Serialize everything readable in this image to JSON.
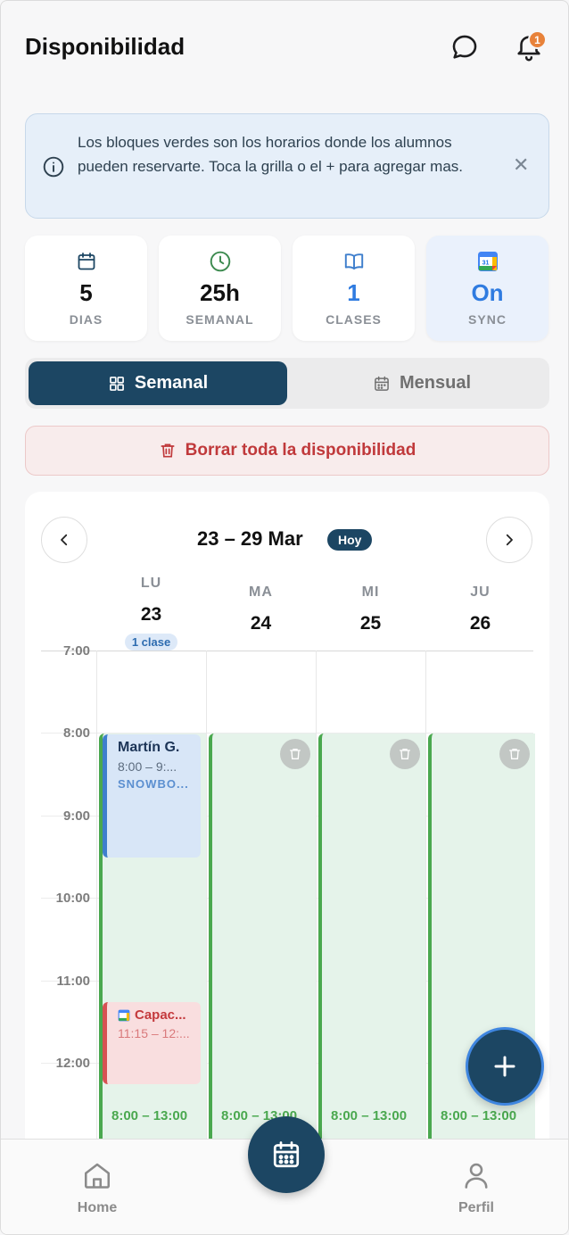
{
  "header": {
    "title": "Disponibilidad",
    "notification_count": "1"
  },
  "info_banner": {
    "text": "Los bloques verdes son los horarios donde los alumnos pueden reservarte. Toca la grilla o el + para agregar mas."
  },
  "stats": [
    {
      "icon": "calendar-icon",
      "value": "5",
      "label": "DIAS"
    },
    {
      "icon": "clock-icon",
      "value": "25h",
      "label": "SEMANAL"
    },
    {
      "icon": "book-icon",
      "value": "1",
      "label": "CLASES"
    },
    {
      "icon": "google-calendar-icon",
      "value": "On",
      "label": "SYNC"
    }
  ],
  "view_toggle": {
    "weekly_label": "Semanal",
    "monthly_label": "Mensual",
    "selected": "Semanal"
  },
  "clear_button": {
    "label": "Borrar toda la disponibilidad"
  },
  "calendar": {
    "range": "23 – 29 Mar",
    "today_label": "Hoy",
    "days": [
      {
        "name": "LU",
        "num": "23",
        "badge": "1 clase"
      },
      {
        "name": "MA",
        "num": "24"
      },
      {
        "name": "MI",
        "num": "25"
      },
      {
        "name": "JU",
        "num": "26"
      }
    ],
    "times": [
      "7:00",
      "8:00",
      "9:00",
      "10:00",
      "11:00",
      "12:00"
    ],
    "availability_label": "8:00 – 13:00",
    "events": {
      "student": {
        "name": "Martín G.",
        "time": "8:00 – 9:...",
        "type": "SNOWBO..."
      },
      "gcal": {
        "name": "Capac...",
        "time": "11:15 – 12:..."
      }
    }
  },
  "tabbar": {
    "home_label": "Home",
    "profile_label": "Perfil"
  },
  "colors": {
    "primary": "#1c4663",
    "availability_green": "#4aa84f",
    "danger": "#c0393b",
    "badge_orange": "#e8823a",
    "sync_blue": "#2f7be0"
  }
}
